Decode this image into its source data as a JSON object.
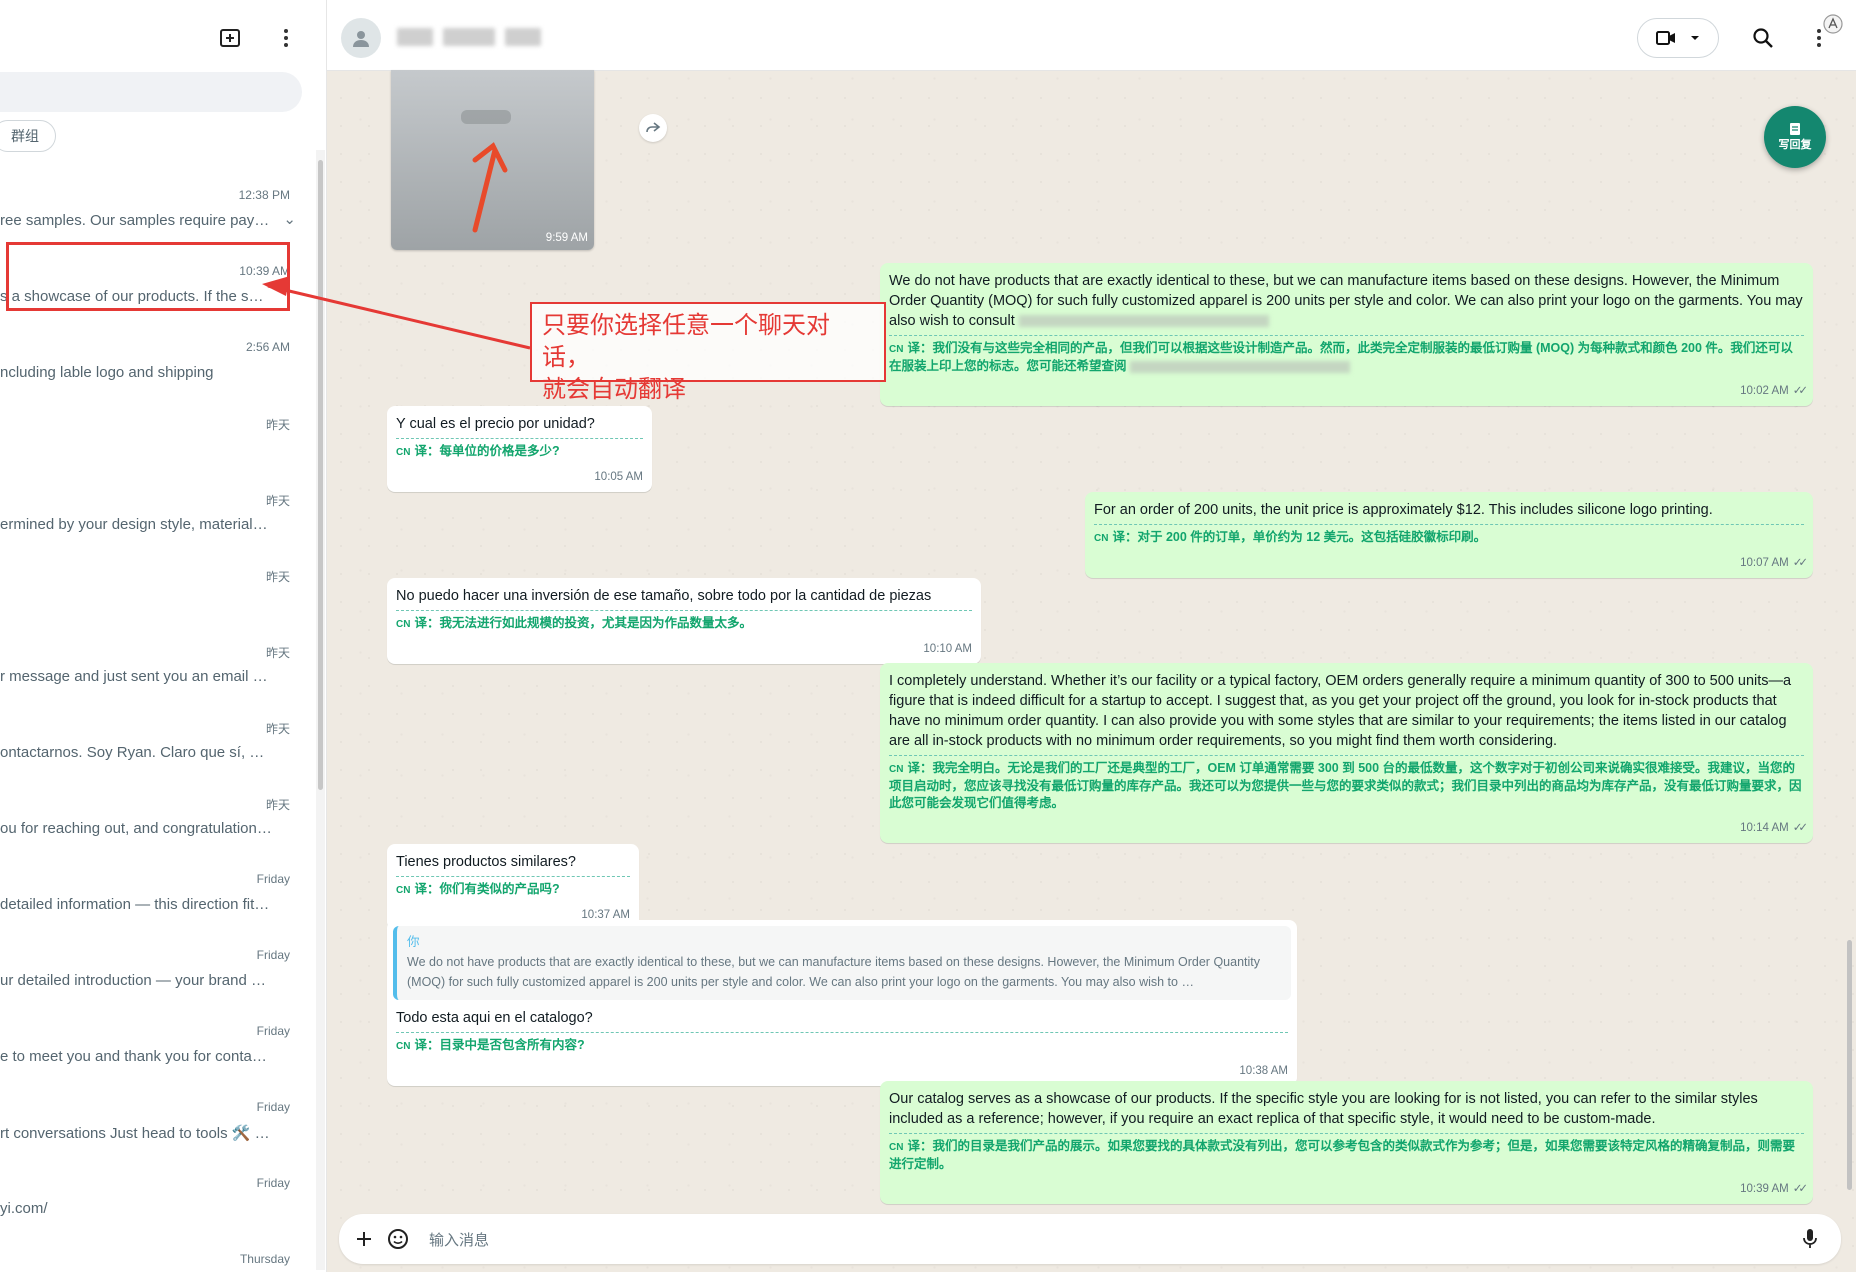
{
  "sidebar": {
    "filter_chip": "群组",
    "chats": [
      {
        "time": "12:38 PM",
        "preview": "ree samples. Our samples require pay…"
      },
      {
        "time": "10:39 AM",
        "preview": "s a showcase of our products. If the s…"
      },
      {
        "time": "2:56 AM",
        "preview": "ncluding lable logo and shipping"
      },
      {
        "time": "昨天",
        "preview": ""
      },
      {
        "time": "昨天",
        "preview": "ermined by your design style, materials, t…"
      },
      {
        "time": "昨天",
        "preview": ""
      },
      {
        "time": "昨天",
        "preview": "r message and just sent you an email wit…"
      },
      {
        "time": "昨天",
        "preview": "ontactarnos. Soy Ryan. Claro que sí, aquí …"
      },
      {
        "time": "昨天",
        "preview": "ou for reaching out, and congratulations o…"
      },
      {
        "time": "Friday",
        "preview": "detailed information — this direction fits v…"
      },
      {
        "time": "Friday",
        "preview": "ur detailed introduction — your brand dire…"
      },
      {
        "time": "Friday",
        "preview": "e to meet you and thank you for contactin…"
      },
      {
        "time": "Friday",
        "preview": "rt conversations  Just head to tools 🛠️ L…"
      },
      {
        "time": "Friday",
        "preview": "yi.com/"
      },
      {
        "time": "Thursday",
        "preview": ""
      }
    ]
  },
  "chat": {
    "image_time": "9:59 AM",
    "floating_button_label": "写回复",
    "translation_prefix": "译：",
    "cn_tag": "CN",
    "messages": [
      {
        "dir": "out",
        "text": "We do not have products that are exactly identical to these, but we can manufacture items based on these designs. However, the Minimum Order Quantity (MOQ) for such fully customized apparel is 200 units per style and color. We can also print your logo on the garments. You may also wish to consult",
        "translation": "我们没有与这些完全相同的产品，但我们可以根据这些设计制造产品。然而，此类完全定制服装的最低订购量 (MOQ) 为每种款式和颜色 200 件。我们还可以在服装上印上您的标志。您可能还希望查阅",
        "time": "10:02 AM"
      },
      {
        "dir": "in",
        "text": "Y cual es el precio por unidad?",
        "translation": "每单位的价格是多少?",
        "time": "10:05 AM"
      },
      {
        "dir": "out",
        "text": "For an order of 200 units, the unit price is approximately $12. This includes silicone logo printing.",
        "translation": "对于 200 件的订单，单价约为 12 美元。这包括硅胶徽标印刷。",
        "time": "10:07 AM"
      },
      {
        "dir": "in",
        "text": "No puedo hacer una inversión de ese tamaño, sobre todo por la cantidad de piezas",
        "translation": "我无法进行如此规模的投资，尤其是因为作品数量太多。",
        "time": "10:10 AM"
      },
      {
        "dir": "out",
        "text": "I completely understand. Whether it’s our facility or a typical factory, OEM orders generally require a minimum quantity of 300 to 500 units—a figure that is indeed difficult for a startup to accept. I suggest that, as you get your project off the ground, you look for in-stock products that have no minimum order quantity. I can also provide you with some styles that are similar to your requirements; the items listed in our catalog are all in-stock products with no minimum order requirements, so you might find them worth considering.",
        "translation": "我完全明白。无论是我们的工厂还是典型的工厂，OEM 订单通常需要 300 到 500 台的最低数量，这个数字对于初创公司来说确实很难接受。我建议，当您的项目启动时，您应该寻找没有最低订购量的库存产品。我还可以为您提供一些与您的要求类似的款式；我们目录中列出的商品均为库存产品，没有最低订购量要求，因此您可能会发现它们值得考虑。",
        "time": "10:14 AM"
      },
      {
        "dir": "in",
        "text": "Tienes productos similares?",
        "translation": "你们有类似的产品吗?",
        "time": "10:37 AM"
      },
      {
        "dir": "in",
        "quote_author": "你",
        "quote_text": "We do not have products that are exactly identical to these, but we can manufacture items based on these designs. However, the Minimum Order Quantity (MOQ) for such fully customized apparel is 200 units per style and color. We can also print your logo on the garments. You may also wish to …",
        "text": "Todo esta aqui en el catalogo?",
        "translation": "目录中是否包含所有内容?",
        "time": "10:38 AM"
      },
      {
        "dir": "out",
        "text": "Our catalog serves as a showcase of our products. If the specific style you are looking for is not listed, you can refer to the similar styles included as a reference; however, if you require an exact replica of that specific style, it would need to be custom-made.",
        "translation": "我们的目录是我们产品的展示。如果您要找的具体款式没有列出，您可以参考包含的类似款式作为参考；但是，如果您需要该特定风格的精确复制品，则需要进行定制。",
        "time": "10:39 AM"
      }
    ]
  },
  "composer": {
    "placeholder": "输入消息"
  },
  "annotation": {
    "callout_line1": "只要你选择任意一个聊天对话，",
    "callout_line2": "就会自动翻译",
    "color": "#e53935"
  },
  "colors": {
    "outgoing": "#d9fdd3",
    "incoming": "#ffffff",
    "translation": "#12a56d",
    "accent": "#14876f"
  }
}
